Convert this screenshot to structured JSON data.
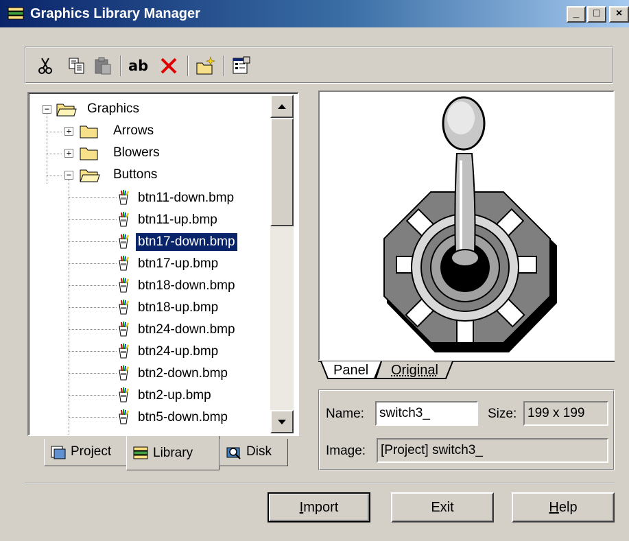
{
  "window": {
    "title": "Graphics Library Manager",
    "controls": {
      "minimize": "_",
      "maximize": "□",
      "close": "×"
    }
  },
  "toolbar": {
    "tools": [
      {
        "name": "cut",
        "icon": "scissors-icon"
      },
      {
        "name": "copy",
        "icon": "copy-icon"
      },
      {
        "name": "paste",
        "icon": "paste-icon"
      },
      {
        "name": "rename",
        "icon": "rename-icon",
        "text": "ab"
      },
      {
        "name": "delete",
        "icon": "delete-icon"
      },
      {
        "name": "new-folder",
        "icon": "new-folder-icon"
      },
      {
        "name": "properties",
        "icon": "properties-icon"
      }
    ]
  },
  "tree": {
    "root": "Graphics",
    "folders": [
      "Arrows",
      "Blowers",
      "Buttons"
    ],
    "files": [
      "btn11-down.bmp",
      "btn11-up.bmp",
      "btn17-down.bmp",
      "btn17-up.bmp",
      "btn18-down.bmp",
      "btn18-up.bmp",
      "btn24-down.bmp",
      "btn24-up.bmp",
      "btn2-down.bmp",
      "btn2-up.bmp",
      "btn5-down.bmp"
    ],
    "selected_file": "btn17-down.bmp"
  },
  "left_tabs": {
    "project": "Project",
    "library": "Library",
    "disk": "Disk",
    "active": "Library"
  },
  "preview_tabs": {
    "panel": "Panel",
    "original": "Original",
    "active": "Panel"
  },
  "info": {
    "name_label": "Name:",
    "name_value": "switch3_",
    "size_label": "Size:",
    "size_value": "199 x 199",
    "image_label": "Image:",
    "image_value": "[Project] switch3_"
  },
  "buttons": {
    "import": {
      "mnemonic": "I",
      "rest": "mport"
    },
    "exit": "Exit",
    "help": {
      "mnemonic": "H",
      "rest": "elp"
    }
  },
  "colors": {
    "face": "#d4d0c8",
    "title_start": "#0a246a",
    "title_end": "#a6caf0",
    "selection": "#0a246a"
  }
}
